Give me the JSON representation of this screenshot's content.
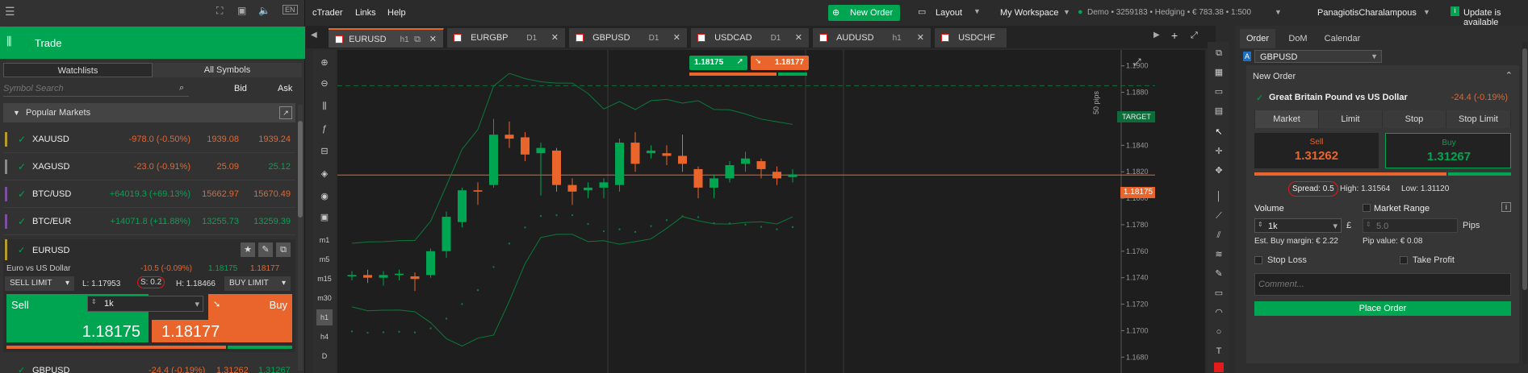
{
  "topbar": {
    "menu_icon": "hamburger-icon",
    "lang": "EN"
  },
  "trade": {
    "title": "Trade"
  },
  "watch_tabs": [
    "Watchlists",
    "All Symbols"
  ],
  "search": {
    "placeholder": "Symbol Search",
    "bid": "Bid",
    "ask": "Ask"
  },
  "popular": {
    "title": "Popular Markets"
  },
  "markets": [
    {
      "symbol": "XAUUSD",
      "change": "-978.0 (-0.50%)",
      "bid": "1939.08",
      "ask": "1939.24",
      "dir": "neg"
    },
    {
      "symbol": "XAGUSD",
      "change": "-23.0 (-0.91%)",
      "bid": "25.09",
      "ask": "25.12",
      "dir": "neg"
    },
    {
      "symbol": "BTC/USD",
      "change": "+64019.3 (+69.13%)",
      "bid": "15662.97",
      "ask": "15670.49",
      "dir": "pos"
    },
    {
      "symbol": "BTC/EUR",
      "change": "+14071.8 (+11.88%)",
      "bid": "13255.73",
      "ask": "13259.39",
      "dir": "pos"
    }
  ],
  "eurusd": {
    "symbol": "EURUSD",
    "name": "Euro vs US Dollar",
    "change": "-10.5 (-0.09%)",
    "bid": "1.18175",
    "ask": "1.18177",
    "order_type": "SELL LIMIT",
    "low": "L: 1.17953",
    "spread": "S: 0.2",
    "high": "H: 1.18466",
    "buy_type": "BUY LIMIT",
    "sell": "Sell",
    "buy": "Buy",
    "volume": "1k",
    "sell_price": "1.18175",
    "buy_price": "1.18177"
  },
  "next_row": {
    "symbol": "GBPUSD",
    "change": "-24.4 (-0.19%)",
    "bid": "1.31262",
    "ask": "1.31267"
  },
  "menu": {
    "app": "cTrader",
    "links": "Links",
    "help": "Help",
    "new_order": "New Order",
    "layout": "Layout",
    "workspace": "My Workspace",
    "account": "Demo • 3259183 • Hedging • € 783.38 • 1:500",
    "user": "PanagiotisCharalampous",
    "update": "Update is available"
  },
  "chart_tabs": [
    {
      "symbol": "EURUSD",
      "tf": "h1",
      "active": true
    },
    {
      "symbol": "EURGBP",
      "tf": "D1",
      "active": false
    },
    {
      "symbol": "GBPUSD",
      "tf": "D1",
      "active": false
    },
    {
      "symbol": "USDCAD",
      "tf": "D1",
      "active": false
    },
    {
      "symbol": "AUDUSD",
      "tf": "h1",
      "active": false
    },
    {
      "symbol": "USDCHF",
      "tf": "",
      "active": false
    }
  ],
  "timeframes": [
    "m1",
    "m5",
    "m15",
    "m30",
    "h1",
    "h4",
    "D"
  ],
  "chart": {
    "sell_quote": "1.18175",
    "buy_quote": "1.18177",
    "target_label": "TARGET",
    "price_tag": "1.18175",
    "pips_label": "50 pips",
    "axis": [
      "1.1900",
      "1.1880",
      "1.1860",
      "1.1840",
      "1.1820",
      "1.1800",
      "1.1780",
      "1.1760",
      "1.1740",
      "1.1720",
      "1.1700",
      "1.1680"
    ]
  },
  "chart_data": {
    "type": "candlestick",
    "symbol": "EURUSD",
    "timeframe": "h1",
    "y_ticks": [
      1.19,
      1.188,
      1.186,
      1.184,
      1.182,
      1.18,
      1.178,
      1.176,
      1.174,
      1.172,
      1.17,
      1.168
    ],
    "current_price": 1.18175,
    "candles": [
      {
        "o": 1.1741,
        "c": 1.1742,
        "h": 1.1745,
        "l": 1.1738
      },
      {
        "o": 1.1742,
        "c": 1.174,
        "h": 1.1746,
        "l": 1.1736
      },
      {
        "o": 1.174,
        "c": 1.1742,
        "h": 1.1745,
        "l": 1.1734
      },
      {
        "o": 1.1742,
        "c": 1.1743,
        "h": 1.1746,
        "l": 1.1738
      },
      {
        "o": 1.1741,
        "c": 1.1739,
        "h": 1.1744,
        "l": 1.173
      },
      {
        "o": 1.1742,
        "c": 1.176,
        "h": 1.1762,
        "l": 1.174
      },
      {
        "o": 1.176,
        "c": 1.1786,
        "h": 1.179,
        "l": 1.1755
      },
      {
        "o": 1.1782,
        "c": 1.1806,
        "h": 1.1808,
        "l": 1.1778
      },
      {
        "o": 1.1806,
        "c": 1.1805,
        "h": 1.1812,
        "l": 1.1795
      },
      {
        "o": 1.181,
        "c": 1.1848,
        "h": 1.186,
        "l": 1.1808
      },
      {
        "o": 1.1848,
        "c": 1.1845,
        "h": 1.1858,
        "l": 1.1838
      },
      {
        "o": 1.1846,
        "c": 1.1833,
        "h": 1.185,
        "l": 1.1828
      },
      {
        "o": 1.1834,
        "c": 1.1838,
        "h": 1.1842,
        "l": 1.1802
      },
      {
        "o": 1.1836,
        "c": 1.181,
        "h": 1.1838,
        "l": 1.1805
      },
      {
        "o": 1.181,
        "c": 1.1805,
        "h": 1.1815,
        "l": 1.1795
      },
      {
        "o": 1.1806,
        "c": 1.1808,
        "h": 1.1812,
        "l": 1.18
      },
      {
        "o": 1.1808,
        "c": 1.1812,
        "h": 1.1815,
        "l": 1.18
      },
      {
        "o": 1.181,
        "c": 1.1842,
        "h": 1.1845,
        "l": 1.1805
      },
      {
        "o": 1.1842,
        "c": 1.1826,
        "h": 1.185,
        "l": 1.182
      },
      {
        "o": 1.1834,
        "c": 1.1836,
        "h": 1.184,
        "l": 1.183
      },
      {
        "o": 1.1834,
        "c": 1.1832,
        "h": 1.184,
        "l": 1.1825
      },
      {
        "o": 1.1832,
        "c": 1.1826,
        "h": 1.1848,
        "l": 1.182
      },
      {
        "o": 1.1822,
        "c": 1.1808,
        "h": 1.1824,
        "l": 1.18
      },
      {
        "o": 1.1808,
        "c": 1.1815,
        "h": 1.1818,
        "l": 1.18
      },
      {
        "o": 1.1815,
        "c": 1.1825,
        "h": 1.1828,
        "l": 1.1812
      },
      {
        "o": 1.1826,
        "c": 1.183,
        "h": 1.1835,
        "l": 1.182
      },
      {
        "o": 1.1828,
        "c": 1.1822,
        "h": 1.183,
        "l": 1.1815
      },
      {
        "o": 1.182,
        "c": 1.1815,
        "h": 1.1824,
        "l": 1.181
      },
      {
        "o": 1.1816,
        "c": 1.1818,
        "h": 1.1822,
        "l": 1.1812
      }
    ]
  },
  "order": {
    "tabs": [
      "Order",
      "DoM",
      "Calendar"
    ],
    "symbol": "GBPUSD",
    "section": "New Order",
    "full_name": "Great Britain Pound vs US Dollar",
    "change": "-24.4 (-0.19%)",
    "types": [
      "Market",
      "Limit",
      "Stop",
      "Stop Limit"
    ],
    "sell": "Sell",
    "buy": "Buy",
    "sell_price": "1.31262",
    "buy_price": "1.31267",
    "spread": "Spread: 0.5",
    "high": "High: 1.31564",
    "low": "Low: 1.31120",
    "volume_label": "Volume",
    "market_range": "Market Range",
    "volume": "1k",
    "currency": "£",
    "range_value": "5.0",
    "pips": "Pips",
    "margin": "Est. Buy margin: € 2.22",
    "pip_value": "Pip value: € 0.08",
    "stop_loss": "Stop Loss",
    "take_profit": "Take Profit",
    "comment_placeholder": "Comment...",
    "place": "Place Order"
  },
  "colors": {
    "green": "#00a551",
    "orange": "#e9652b",
    "panel": "#323232",
    "chart_bg": "#1e1e1e"
  }
}
